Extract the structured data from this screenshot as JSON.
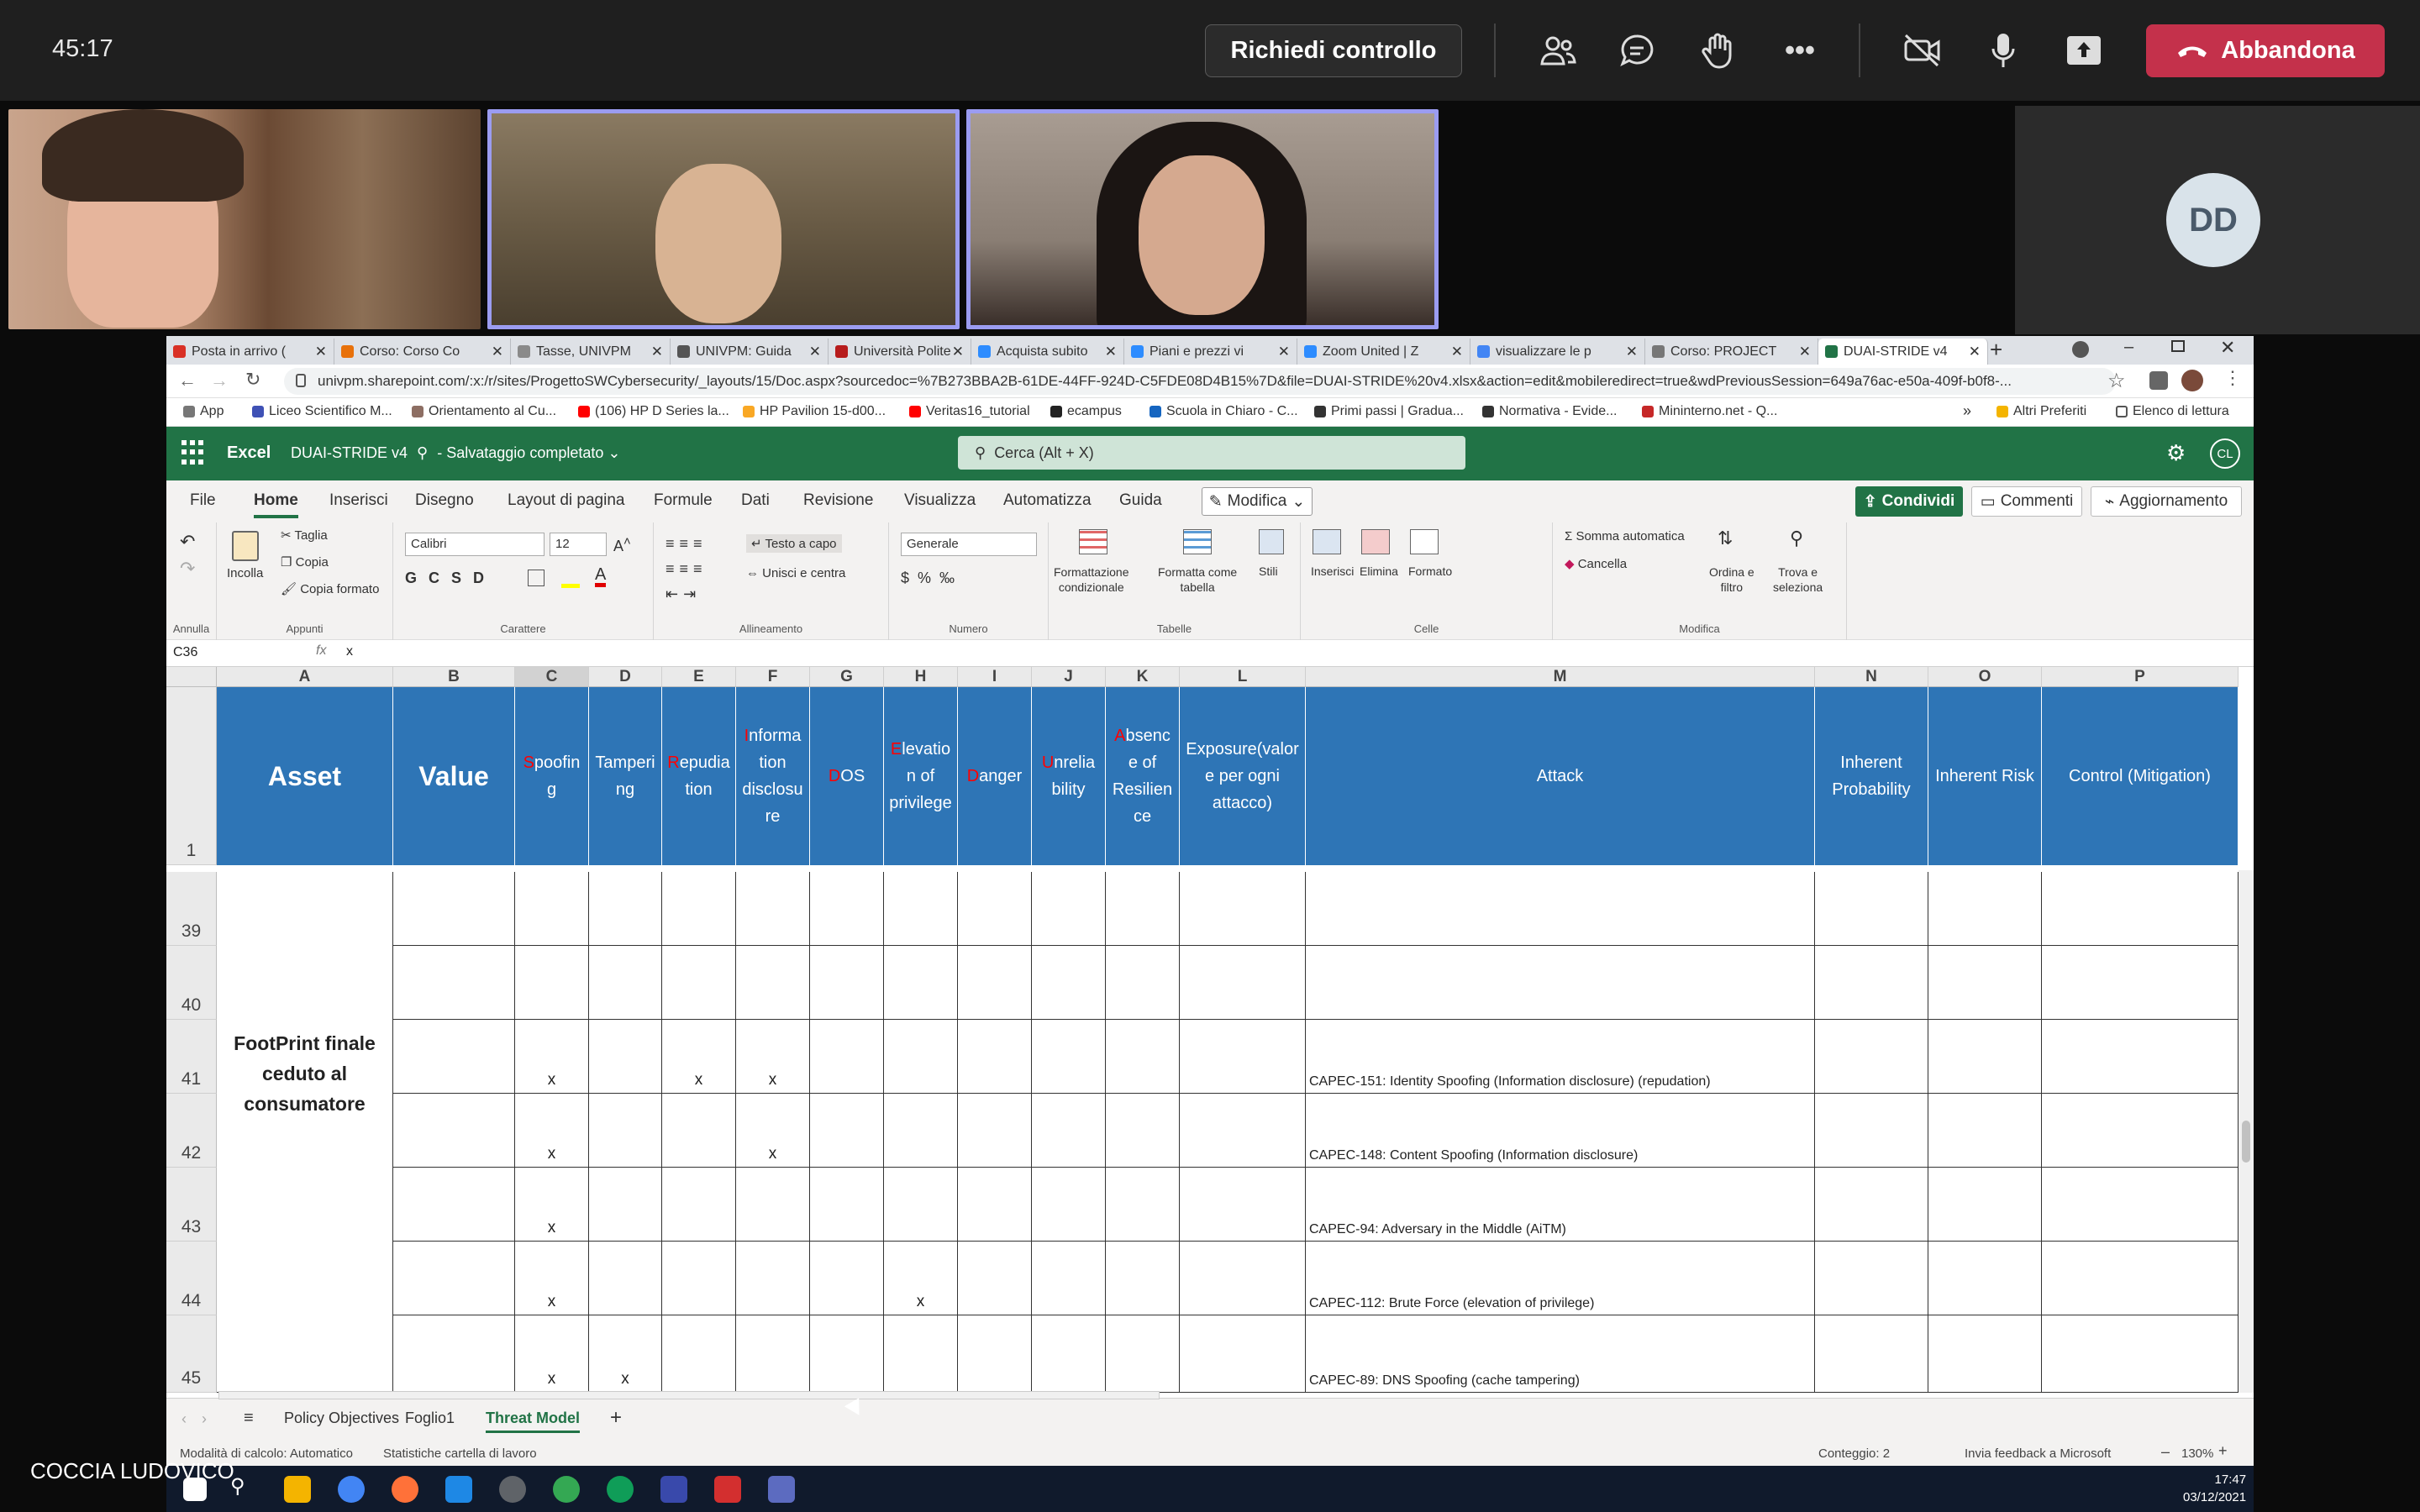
{
  "meeting": {
    "timer": "45:17",
    "control_label": "Richiedi controllo",
    "leave_label": "Abbandona",
    "avatar_initials": "DD",
    "presenter_name": "COCCIA LUDOVICO"
  },
  "browser": {
    "tabs": [
      {
        "label": "Posta in arrivo (",
        "color": "#d93025"
      },
      {
        "label": "Corso: Corso Co",
        "color": "#e8710a"
      },
      {
        "label": "Tasse, UNIVPM",
        "color": "#8a8a8a"
      },
      {
        "label": "UNIVPM: Guida",
        "color": "#555555"
      },
      {
        "label": "Università Polite",
        "color": "#b71c1c"
      },
      {
        "label": "Acquista subito",
        "color": "#2d8cff"
      },
      {
        "label": "Piani e prezzi vi",
        "color": "#2d8cff"
      },
      {
        "label": "Zoom United | Z",
        "color": "#2d8cff"
      },
      {
        "label": "visualizzare le p",
        "color": "#4285f4"
      },
      {
        "label": "Corso: PROJECT",
        "color": "#777777"
      },
      {
        "label": "DUAI-STRIDE v4",
        "color": "#217346"
      }
    ],
    "url": "univpm.sharepoint.com/:x:/r/sites/ProgettoSWCybersecurity/_layouts/15/Doc.aspx?sourcedoc=%7B273BBA2B-61DE-44FF-924D-C5FDE08D4B15%7D&file=DUAI-STRIDE%20v4.xlsx&action=edit&mobileredirect=true&wdPreviousSession=649a76ac-e50a-409f-b0f8-...",
    "bookmarks": [
      {
        "label": "App",
        "color": "#777"
      },
      {
        "label": "Liceo Scientifico M...",
        "color": "#3f51b5"
      },
      {
        "label": "Orientamento al Cu...",
        "color": "#8d6e63"
      },
      {
        "label": "(106) HP D Series la...",
        "color": "#ff0000"
      },
      {
        "label": "HP Pavilion 15-d00...",
        "color": "#f9a825"
      },
      {
        "label": "Veritas16_tutorial",
        "color": "#ff0000"
      },
      {
        "label": "ecampus",
        "color": "#222"
      },
      {
        "label": "Scuola in Chiaro - C...",
        "color": "#1565c0"
      },
      {
        "label": "Primi passi | Gradua...",
        "color": "#333"
      },
      {
        "label": "Normativa - Evide...",
        "color": "#333"
      },
      {
        "label": "Mininterno.net - Q...",
        "color": "#c62828"
      }
    ],
    "bookmarks_right": [
      "Altri Preferiti",
      "Elenco di lettura"
    ]
  },
  "excel": {
    "app_name": "Excel",
    "file_title": "DUAI-STRIDE v4",
    "save_status": "Salvataggio completato",
    "search_placeholder": "Cerca (Alt + X)",
    "user_initials": "CL",
    "menu": [
      "File",
      "Home",
      "Inserisci",
      "Disegno",
      "Layout di pagina",
      "Formule",
      "Dati",
      "Revisione",
      "Visualizza",
      "Automatizza",
      "Guida"
    ],
    "active_menu": "Home",
    "modify_label": "Modifica",
    "share_label": "Condividi",
    "comments_label": "Commenti",
    "updates_label": "Aggiornamento",
    "ribbon": {
      "undo_group": "Annulla",
      "paste": "Incolla",
      "cut": "Taglia",
      "copy": "Copia",
      "format_painter": "Copia formato",
      "clipboard_group": "Appunti",
      "font": "Calibri",
      "font_size": "12",
      "font_group": "Carattere",
      "wrap_text": "Testo a capo",
      "merge_center": "Unisci e centra",
      "align_group": "Allineamento",
      "number_format": "Generale",
      "number_group": "Numero",
      "cond_format": [
        "Formattazione",
        "condizionale"
      ],
      "format_table": [
        "Formatta come",
        "tabella"
      ],
      "styles": "Stili",
      "tables_group": "Tabelle",
      "insert": "Inserisci",
      "delete": "Elimina",
      "format": "Formato",
      "cells_group": "Celle",
      "autosum": "Somma automatica",
      "clear": "Cancella",
      "sort_filter": [
        "Ordina e",
        "filtro"
      ],
      "find_select": [
        "Trova e",
        "seleziona"
      ],
      "edit_group": "Modifica"
    },
    "name_box": "C36",
    "formula": "x",
    "columns": [
      "A",
      "B",
      "C",
      "D",
      "E",
      "F",
      "G",
      "H",
      "I",
      "J",
      "K",
      "L",
      "M",
      "N",
      "O",
      "P"
    ],
    "header_row": "1",
    "headers": {
      "A": "Asset",
      "B": "Value",
      "C": [
        "S",
        "poofin",
        "g"
      ],
      "D": "Tamperi ng",
      "E": [
        "R",
        "epudia",
        "tion"
      ],
      "F": [
        "I",
        "nforma",
        "tion disclosu re"
      ],
      "G": [
        "D",
        "OS",
        ""
      ],
      "H": [
        "E",
        "levatio",
        "n of privilege"
      ],
      "I": [
        "D",
        "anger",
        ""
      ],
      "J": [
        "U",
        "nrelia",
        "bility"
      ],
      "K": [
        "A",
        "bsenc",
        "e of Resilien ce"
      ],
      "L": "Exposure(valor e per ogni attacco)",
      "M": "Attack",
      "N": "Inherent Probability",
      "O": "Inherent Risk",
      "P": "Control (Mitigation)"
    },
    "asset_label": "FootPrint finale ceduto al consumatore",
    "rows": [
      {
        "n": "39",
        "C": "",
        "E": "",
        "F": "",
        "H": "",
        "attack": ""
      },
      {
        "n": "40",
        "C": "",
        "E": "",
        "F": "",
        "H": "",
        "attack": ""
      },
      {
        "n": "41",
        "C": "x",
        "E": "x",
        "F": "x",
        "H": "",
        "attack": "CAPEC-151: Identity Spoofing (Information disclosure) (repudation)"
      },
      {
        "n": "42",
        "C": "x",
        "E": "",
        "F": "x",
        "H": "",
        "attack": "CAPEC-148: Content Spoofing (Information disclosure)"
      },
      {
        "n": "43",
        "C": "x",
        "E": "",
        "F": "",
        "H": "",
        "attack": "CAPEC-94: Adversary in the Middle (AiTM)"
      },
      {
        "n": "44",
        "C": "x",
        "E": "",
        "F": "",
        "H": "x",
        "attack": "CAPEC-112: Brute Force (elevation of privilege)"
      },
      {
        "n": "45",
        "C": "x",
        "D": "x",
        "E": "",
        "F": "",
        "H": "",
        "attack": "CAPEC-89: DNS Spoofing (cache tampering)"
      }
    ],
    "sheets": [
      "Policy Objectives",
      "Foglio1",
      "Threat Model"
    ],
    "active_sheet": "Threat Model",
    "status_left": "Modalità di calcolo: Automatico",
    "status_stats": "Statistiche cartella di lavoro",
    "status_count": "Conteggio: 2",
    "status_feedback": "Invia feedback a Microsoft",
    "zoom": "130%"
  },
  "taskbar": {
    "time": "17:47",
    "date": "03/12/2021"
  }
}
